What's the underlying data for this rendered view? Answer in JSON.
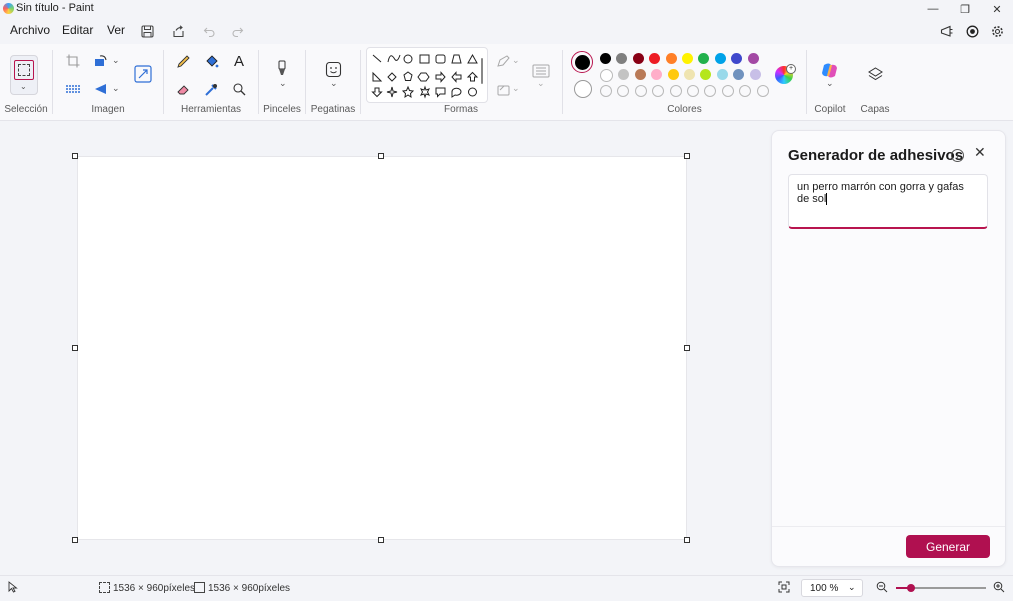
{
  "window": {
    "title": "Sin título - Paint",
    "minimize": "—",
    "restore": "❐",
    "close": "✕"
  },
  "menu": {
    "archivo": "Archivo",
    "editar": "Editar",
    "ver": "Ver"
  },
  "ribbon": {
    "groups": {
      "seleccion": "Selección",
      "imagen": "Imagen",
      "herramientas": "Herramientas",
      "pinceles": "Pinceles",
      "pegatinas": "Pegatinas",
      "formas": "Formas",
      "colores": "Colores",
      "copilot": "Copilot",
      "capas": "Capas"
    },
    "colors": {
      "primary": "#000000",
      "secondary": "#ffffff",
      "row1": [
        "#000000",
        "#7f7f7f",
        "#880015",
        "#ed1c24",
        "#ff7f27",
        "#fff200",
        "#22b14c",
        "#00a2e8",
        "#3f48cc",
        "#a349a4"
      ],
      "row2": [
        "#ffffff",
        "#c3c3c3",
        "#b97a57",
        "#ffaec9",
        "#ffc90e",
        "#efe4b0",
        "#b5e61d",
        "#99d9ea",
        "#7092be",
        "#c8bfe7"
      ]
    }
  },
  "panel": {
    "title": "Generador de adhesivos",
    "prompt_value": "un perro marrón con gorra y gafas de sol",
    "generate_label": "Generar"
  },
  "status": {
    "selection_size": "1536 × 960píxeles",
    "canvas_size": "1536 × 960píxeles",
    "zoom": "100 %"
  },
  "accent": "#b01050"
}
